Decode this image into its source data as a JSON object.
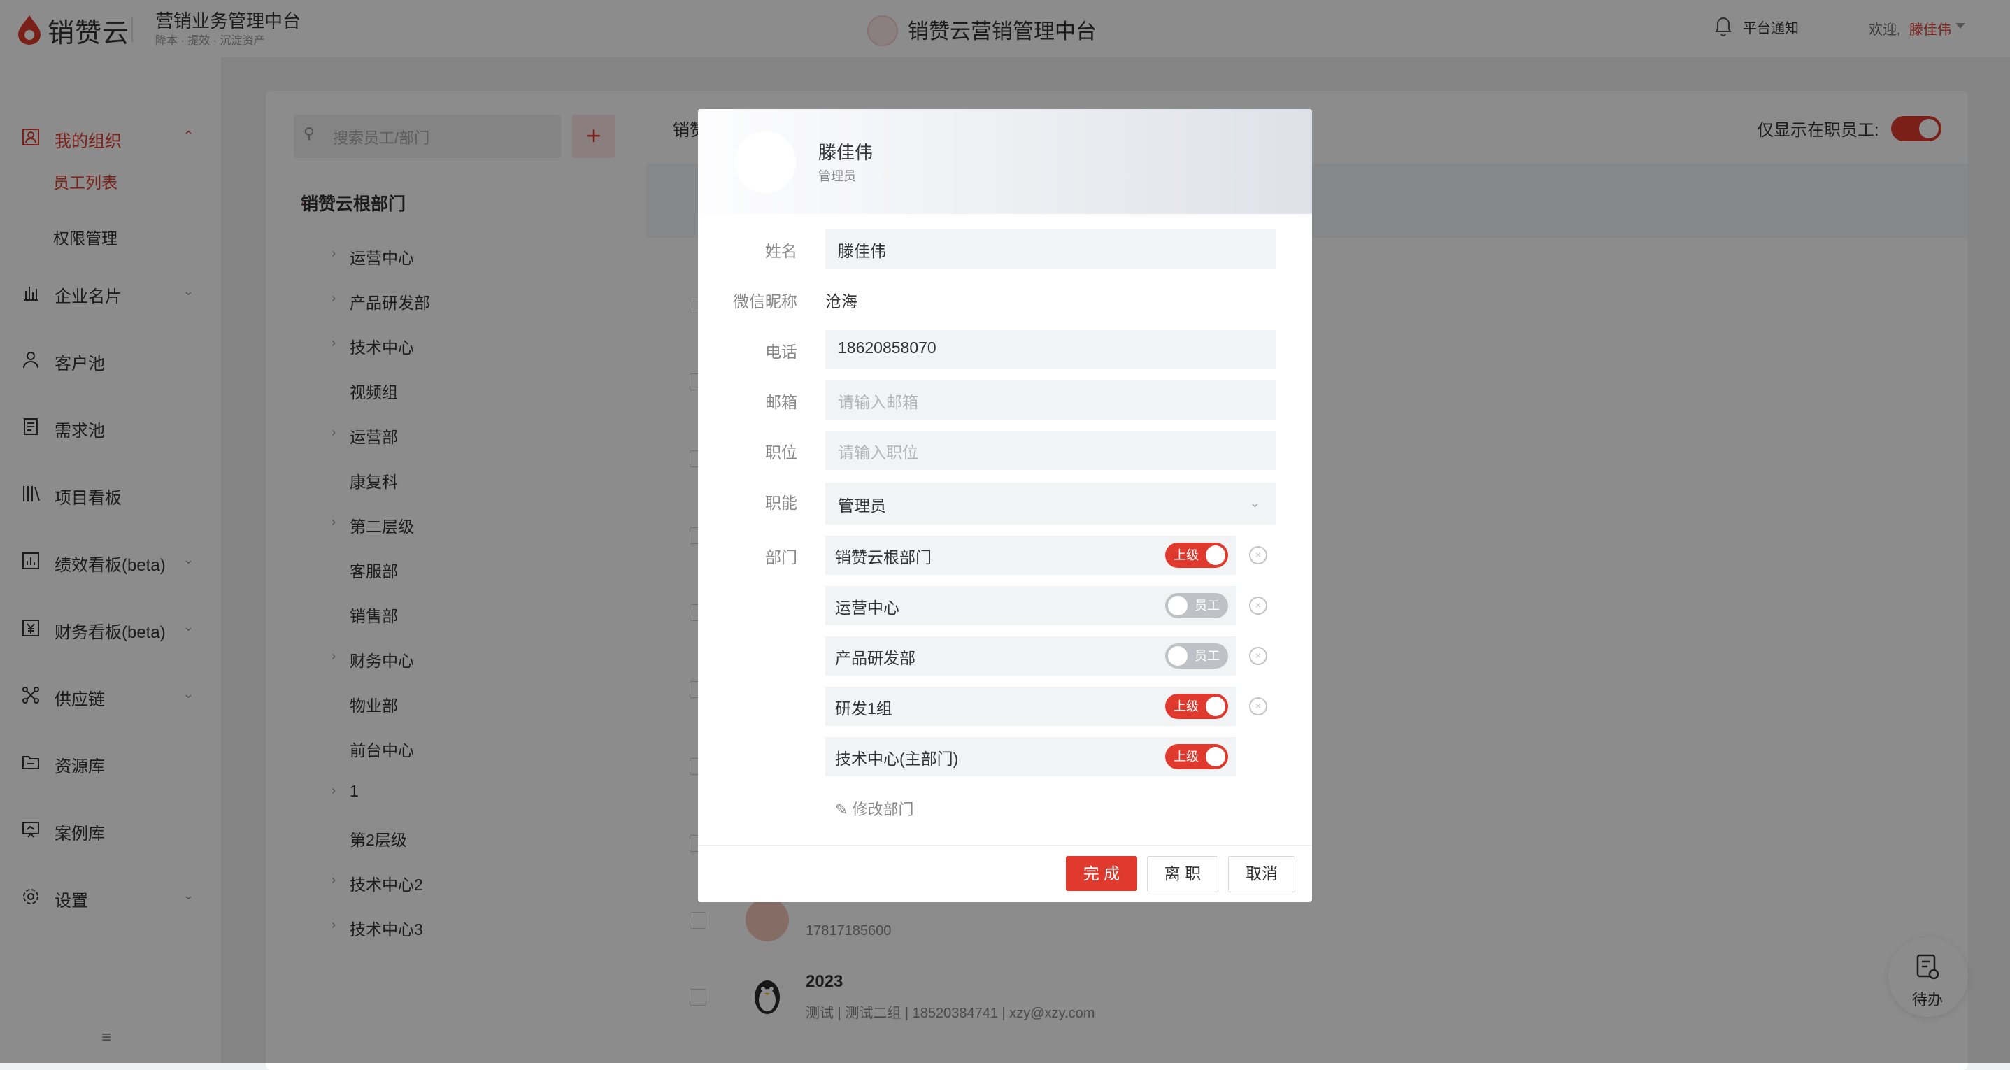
{
  "header": {
    "logo_text": "销赞云",
    "app_title": "营销业务管理中台",
    "app_subtitle": "降本 · 提效 · 沉淀资产",
    "center_title": "销赞云营销管理中台",
    "notice": "平台通知",
    "welcome": "欢迎,",
    "user_name": "滕佳伟"
  },
  "sidebar": {
    "org": "我的组织",
    "org_sub": [
      "员工列表",
      "权限管理"
    ],
    "items": [
      {
        "label": "企业名片",
        "icon": "chart-bar-icon",
        "has_chevron": true
      },
      {
        "label": "客户池",
        "icon": "user-icon",
        "has_chevron": false
      },
      {
        "label": "需求池",
        "icon": "document-icon",
        "has_chevron": false
      },
      {
        "label": "项目看板",
        "icon": "board-icon",
        "has_chevron": false
      },
      {
        "label": "绩效看板(beta)",
        "icon": "chart-icon",
        "has_chevron": true
      },
      {
        "label": "财务看板(beta)",
        "icon": "yen-icon",
        "has_chevron": true
      },
      {
        "label": "供应链",
        "icon": "network-icon",
        "has_chevron": true
      },
      {
        "label": "资源库",
        "icon": "folder-icon",
        "has_chevron": false
      },
      {
        "label": "案例库",
        "icon": "case-icon",
        "has_chevron": false
      },
      {
        "label": "设置",
        "icon": "gear-icon",
        "has_chevron": true
      }
    ]
  },
  "tree": {
    "search_placeholder": "搜索员工/部门",
    "add": "+",
    "root": "销赞云根部门",
    "items": [
      {
        "label": "运营中心",
        "arrow": true
      },
      {
        "label": "产品研发部",
        "arrow": true
      },
      {
        "label": "技术中心",
        "arrow": true
      },
      {
        "label": "视频组",
        "arrow": false
      },
      {
        "label": "运营部",
        "arrow": true
      },
      {
        "label": "康复科",
        "arrow": false
      },
      {
        "label": "第二层级",
        "arrow": true
      },
      {
        "label": "客服部",
        "arrow": false
      },
      {
        "label": "销售部",
        "arrow": false
      },
      {
        "label": "财务中心",
        "arrow": true
      },
      {
        "label": "物业部",
        "arrow": false
      },
      {
        "label": "前台中心",
        "arrow": false
      },
      {
        "label": "1",
        "arrow": true
      },
      {
        "label": "第2层级",
        "arrow": false
      },
      {
        "label": "技术中心2",
        "arrow": true
      },
      {
        "label": "技术中心3",
        "arrow": true
      }
    ]
  },
  "main": {
    "crumb": "销赞",
    "only_active_label": "仅显示在职员工:",
    "only_active": true,
    "emp_phone": "17817185600",
    "emp2_name": "2023",
    "emp2_meta": "测试  |  测试二组  |  18520384741  |  xzy@xzy.com",
    "todo": "待办"
  },
  "modal": {
    "name": "滕佳伟",
    "role": "管理员",
    "fields": {
      "name_label": "姓名",
      "name_value": "滕佳伟",
      "wechat_label": "微信昵称",
      "wechat_value": "沧海",
      "phone_label": "电话",
      "phone_value": "18620858070",
      "email_label": "邮箱",
      "email_placeholder": "请输入邮箱",
      "position_label": "职位",
      "position_placeholder": "请输入职位",
      "func_label": "职能",
      "func_value": "管理员",
      "dept_label": "部门"
    },
    "depts": [
      {
        "name": "销赞云根部门",
        "switch": "上级",
        "on": true,
        "removable": true
      },
      {
        "name": "运营中心",
        "switch": "员工",
        "on": false,
        "removable": true
      },
      {
        "name": "产品研发部",
        "switch": "员工",
        "on": false,
        "removable": true
      },
      {
        "name": "研发1组",
        "switch": "上级",
        "on": true,
        "removable": true
      },
      {
        "name": "技术中心(主部门)",
        "switch": "上级",
        "on": true,
        "removable": false
      }
    ],
    "edit_dept": "修改部门",
    "buttons": {
      "done": "完 成",
      "leave": "离 职",
      "cancel": "取消"
    }
  },
  "colors": {
    "accent": "#e03a2e"
  }
}
